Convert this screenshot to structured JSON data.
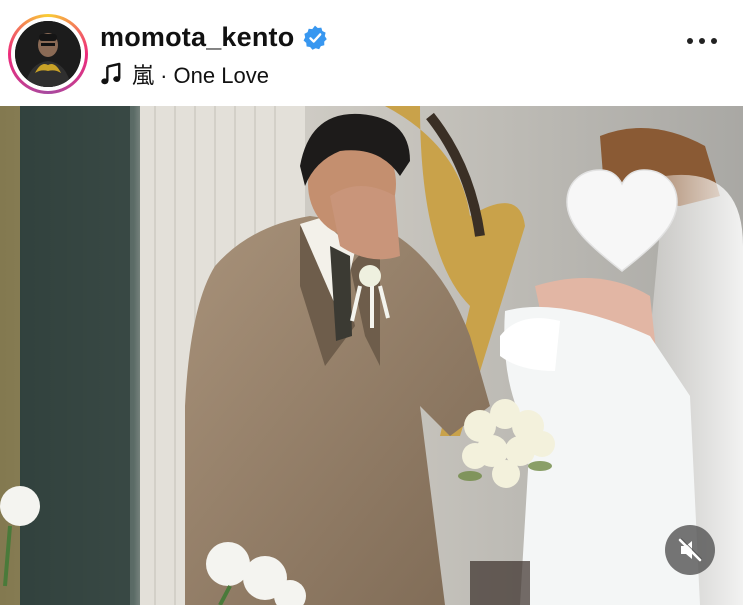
{
  "post": {
    "username": "momota_kento",
    "verified": true,
    "music": {
      "icon": "music-note-icon",
      "text": "嵐 · One Love"
    },
    "more_icon": "more-horizontal-icon"
  },
  "media": {
    "type": "photo",
    "audio_icon": "muted-speaker-icon"
  },
  "colors": {
    "verified_badge": "#3897f0",
    "story_ring_start": "#f9ce34",
    "story_ring_end": "#ee2a7b"
  }
}
